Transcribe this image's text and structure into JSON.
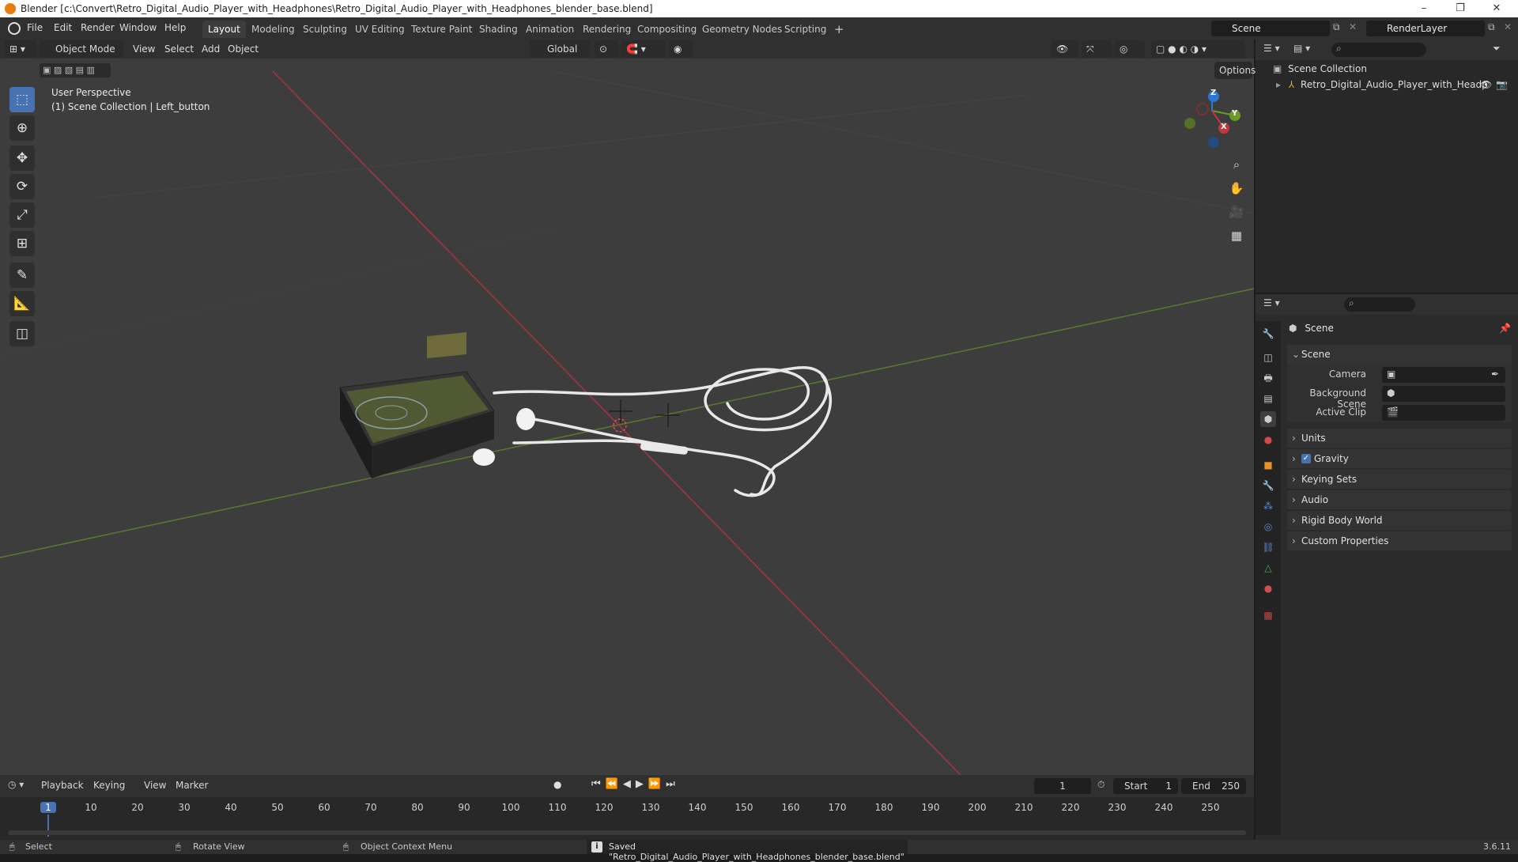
{
  "window": {
    "title": "Blender [c:\\Convert\\Retro_Digital_Audio_Player_with_Headphones\\Retro_Digital_Audio_Player_with_Headphones_blender_base.blend]",
    "minimize": "–",
    "maximize": "❐",
    "close": "✕"
  },
  "menu": {
    "items": [
      "File",
      "Edit",
      "Render",
      "Window",
      "Help"
    ]
  },
  "workspaces": {
    "tabs": [
      "Layout",
      "Modeling",
      "Sculpting",
      "UV Editing",
      "Texture Paint",
      "Shading",
      "Animation",
      "Rendering",
      "Compositing",
      "Geometry Nodes",
      "Scripting"
    ],
    "active": "Layout",
    "add": "+"
  },
  "scene_selector": {
    "value": "Scene"
  },
  "view_layer": {
    "value": "RenderLayer"
  },
  "viewport_header": {
    "mode": "Object Mode",
    "menus": [
      "View",
      "Select",
      "Add",
      "Object"
    ],
    "orientation": "Global",
    "options": "Options"
  },
  "viewport": {
    "perspective": "User Perspective",
    "collection_info": "(1) Scene Collection | Left_button",
    "gizmo": {
      "x": "X",
      "y": "Y",
      "z": "Z"
    }
  },
  "outliner": {
    "root": "Scene Collection",
    "object": "Retro_Digital_Audio_Player_with_Headp"
  },
  "properties": {
    "header": "Scene",
    "panel_scene": "Scene",
    "camera_label": "Camera",
    "background_scene_label": "Background Scene",
    "active_clip_label": "Active Clip",
    "collapsed_panels": [
      "Units",
      "Gravity",
      "Keying Sets",
      "Audio",
      "Rigid Body World",
      "Custom Properties"
    ],
    "gravity_checked": true
  },
  "timeline": {
    "menus": [
      "Playback",
      "Keying",
      "View",
      "Marker"
    ],
    "current_frame": "1",
    "start_label": "Start",
    "start": "1",
    "end_label": "End",
    "end": "250",
    "ticks": [
      "1",
      "10",
      "20",
      "30",
      "40",
      "50",
      "60",
      "70",
      "80",
      "90",
      "100",
      "110",
      "120",
      "130",
      "140",
      "150",
      "160",
      "170",
      "180",
      "190",
      "200",
      "210",
      "220",
      "230",
      "240",
      "250"
    ]
  },
  "statusbar": {
    "select": "Select",
    "rotate": "Rotate View",
    "context": "Object Context Menu",
    "message": "Saved \"Retro_Digital_Audio_Player_with_Headphones_blender_base.blend\"",
    "version": "3.6.11"
  },
  "colors": {
    "accent": "#4772b3",
    "x_axis": "#c4363f",
    "y_axis": "#6b9a2a",
    "z_axis": "#2f76d2"
  }
}
